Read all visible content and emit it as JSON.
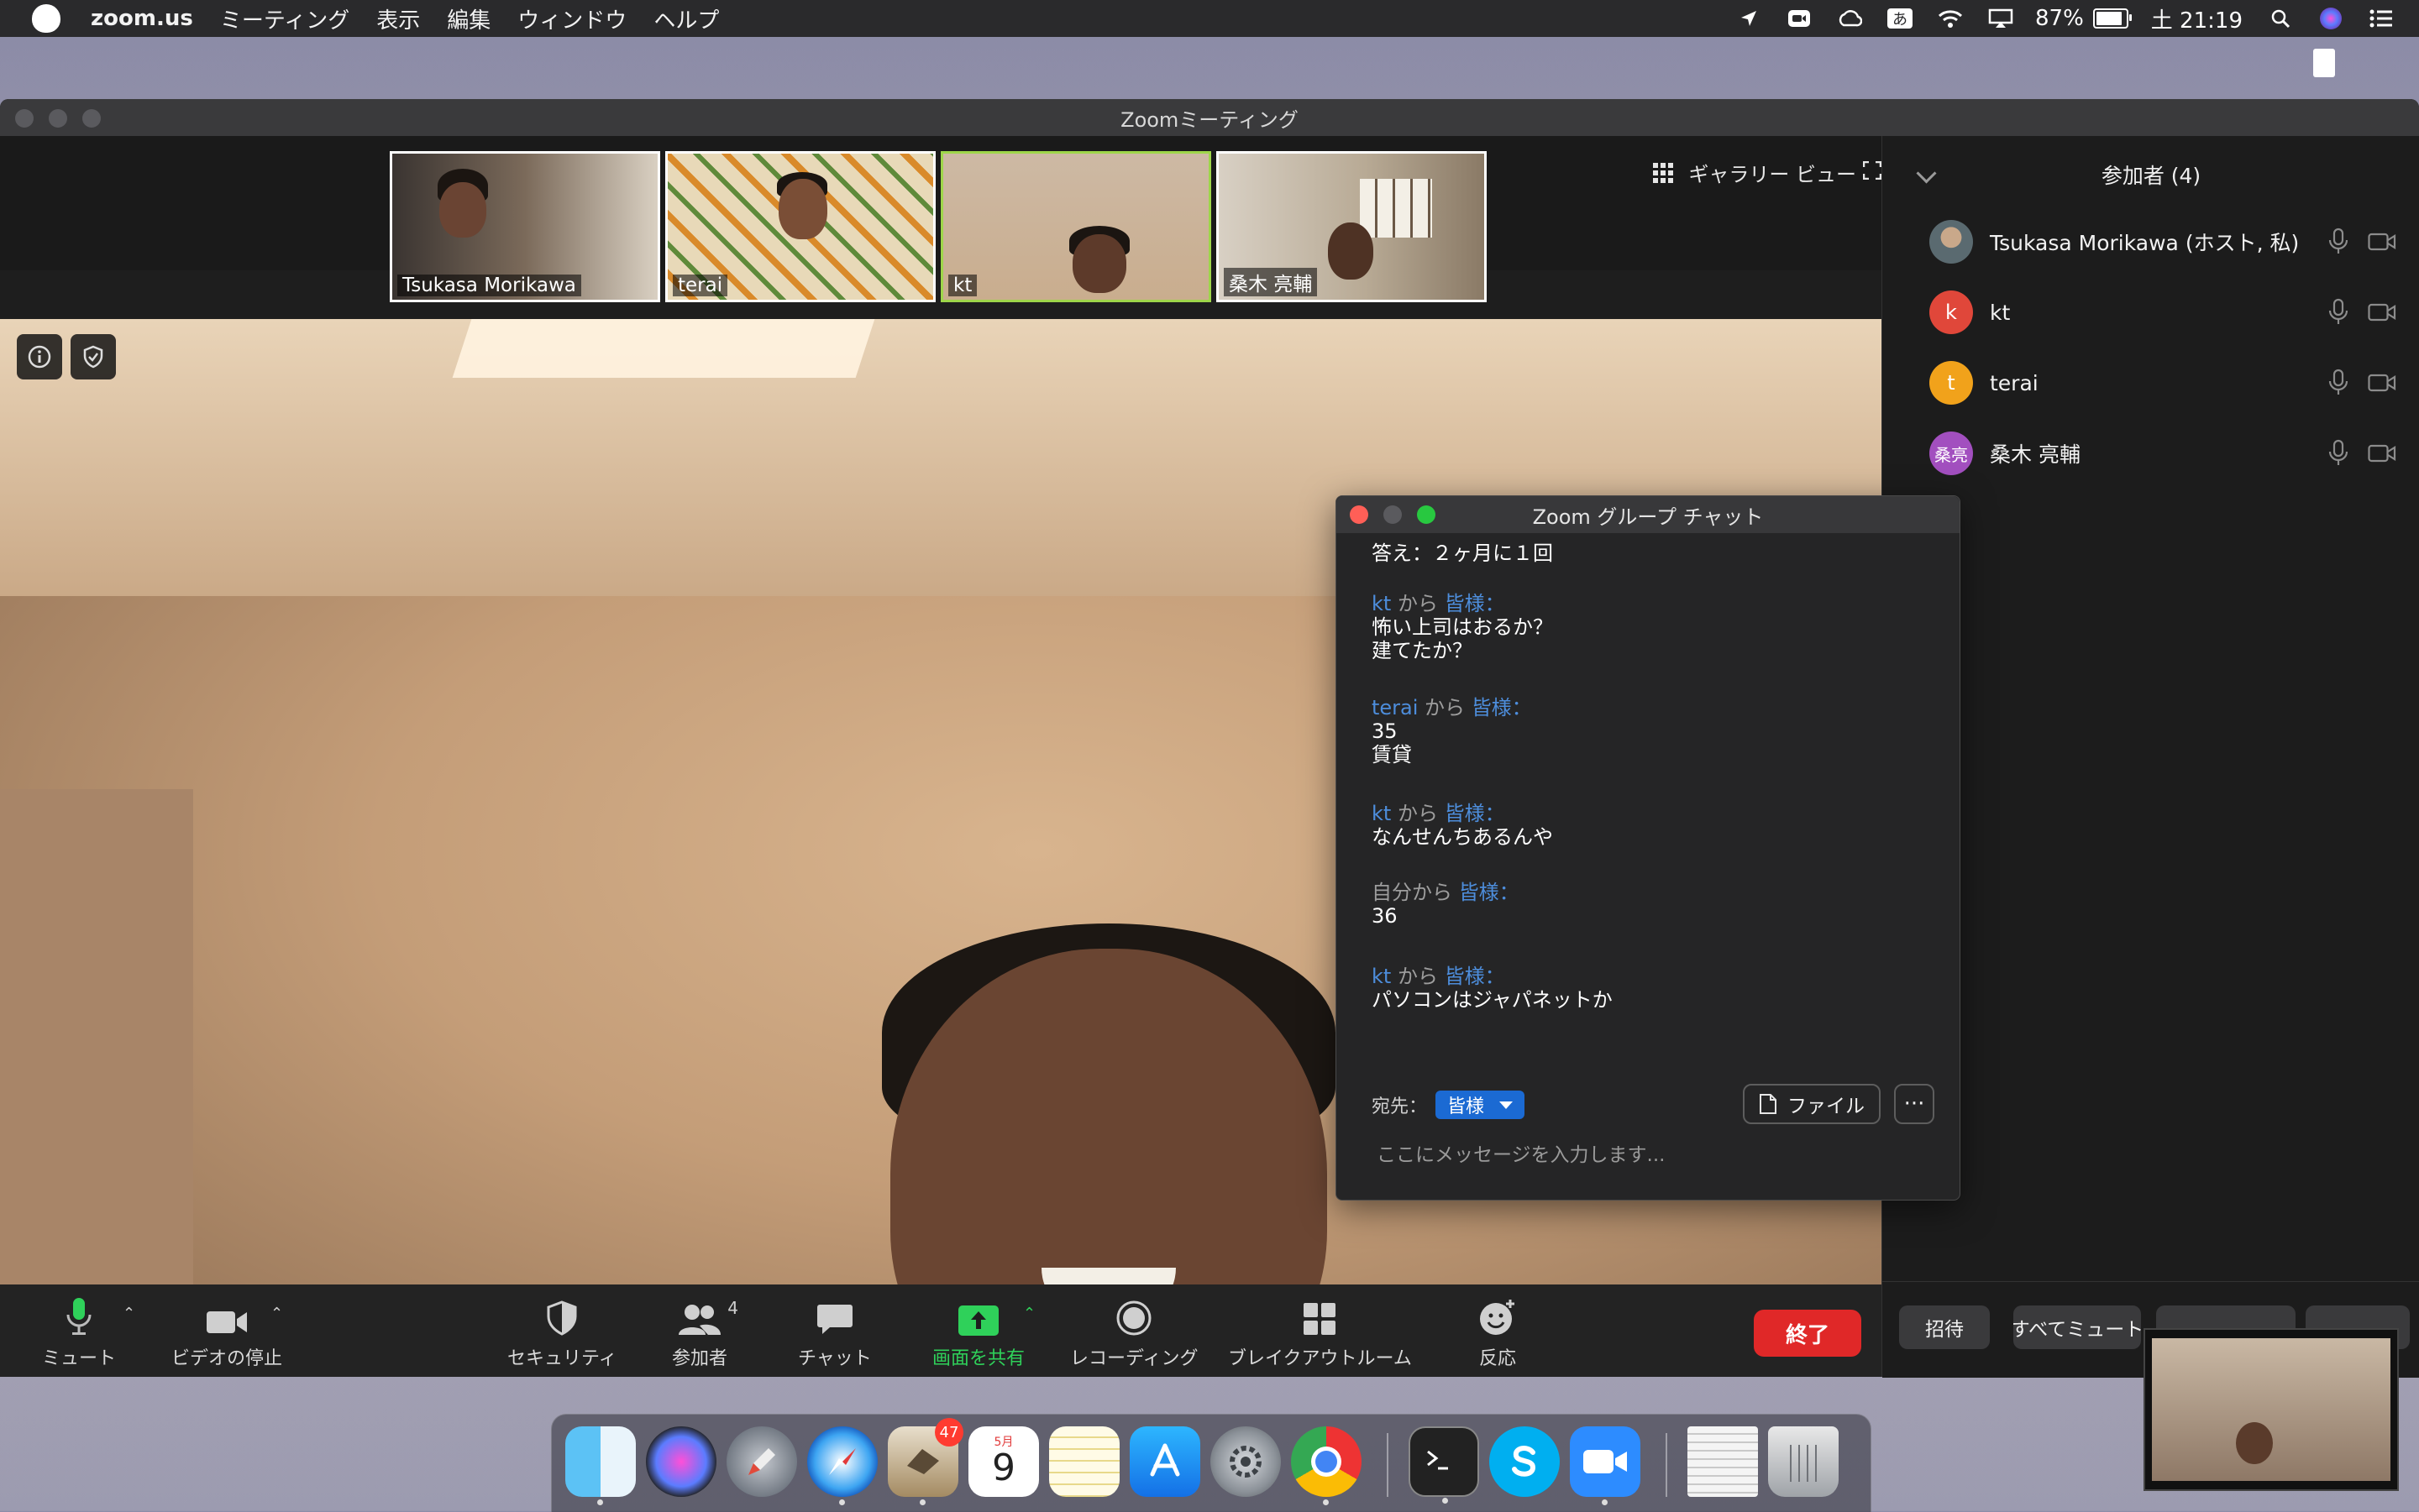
{
  "menubar": {
    "app_name": "zoom.us",
    "menus": [
      "ミーティング",
      "表示",
      "編集",
      "ウィンドウ",
      "ヘルプ"
    ],
    "battery_percent": "87%",
    "battery_level": 0.87,
    "clock": "土 21:19",
    "status_icons": [
      "location-arrow-icon",
      "zoom-status-icon",
      "creative-cloud-icon",
      "input-method-icon",
      "wifi-icon",
      "airplay-icon",
      "battery-icon",
      "spotlight-icon",
      "siri-icon",
      "notification-center-icon"
    ],
    "input_method": "あ"
  },
  "window": {
    "title": "Zoomミーティング"
  },
  "gallery": {
    "view_label": "ギャラリー ビュー",
    "thumbnails": [
      {
        "name": "Tsukasa Morikawa",
        "active": false
      },
      {
        "name": "terai",
        "active": false
      },
      {
        "name": "kt",
        "active": true
      },
      {
        "name": "桑木 亮輔",
        "active": false
      }
    ]
  },
  "toolbar": {
    "mute": "ミュート",
    "stop_video": "ビデオの停止",
    "security": "セキュリティ",
    "participants": "参加者",
    "participants_count": "4",
    "chat": "チャット",
    "share_screen": "画面を共有",
    "recording": "レコーディング",
    "breakout": "ブレイクアウトルーム",
    "reactions": "反応",
    "end": "終了"
  },
  "participants_panel": {
    "title": "参加者 (4)",
    "participants": [
      {
        "name": "Tsukasa Morikawa (ホスト, 私)",
        "avatar_letter": "",
        "avatar_color": "#6b6f73"
      },
      {
        "name": "kt",
        "avatar_letter": "k",
        "avatar_color": "#e0473a"
      },
      {
        "name": "terai",
        "avatar_letter": "t",
        "avatar_color": "#f1a21b"
      },
      {
        "name": "桑木 亮輔",
        "avatar_letter": "桑亮",
        "avatar_color": "#a24fbf"
      }
    ],
    "footer": {
      "invite": "招待",
      "mute_all": "すべてミュート"
    }
  },
  "chat": {
    "title": "Zoom グループ チャット",
    "messages": [
      {
        "sender": "",
        "from_word": "",
        "to": "",
        "body": "答え：２ヶ月に１回"
      },
      {
        "sender": "kt",
        "from_word": " から ",
        "to": "皆様：",
        "body": "怖い上司はおるか？\n建てたか？"
      },
      {
        "sender": "terai",
        "from_word": " から ",
        "to": "皆様：",
        "body": "35\n賃貸"
      },
      {
        "sender": "kt",
        "from_word": " から ",
        "to": "皆様：",
        "body": "なんせんちあるんや"
      },
      {
        "sender": "",
        "from_word": "自分から ",
        "to": "皆様：",
        "body": "36"
      },
      {
        "sender": "kt",
        "from_word": " から ",
        "to": "皆様：",
        "body": "パソコンはジャパネットか"
      }
    ],
    "to_label": "宛先：",
    "recipient": "皆様",
    "file_button": "ファイル",
    "more_button": "···",
    "input_placeholder": "ここにメッセージを入力します..."
  },
  "dock": {
    "items": [
      "finder-icon",
      "siri-icon",
      "launchpad-icon",
      "safari-icon",
      "mail-icon",
      "calendar-icon",
      "notes-icon",
      "app-store-icon",
      "system-preferences-icon",
      "chrome-icon",
      "terminal-icon",
      "skype-icon",
      "zoom-icon",
      "document-icon",
      "trash-icon"
    ],
    "mail_badge": "47",
    "calendar_month": "5月",
    "calendar_day": "9"
  },
  "colors": {
    "accent_blue": "#1b6ad3",
    "end_red": "#e02828",
    "share_green": "#2fd15a",
    "active_speaker": "#9ed64a"
  }
}
